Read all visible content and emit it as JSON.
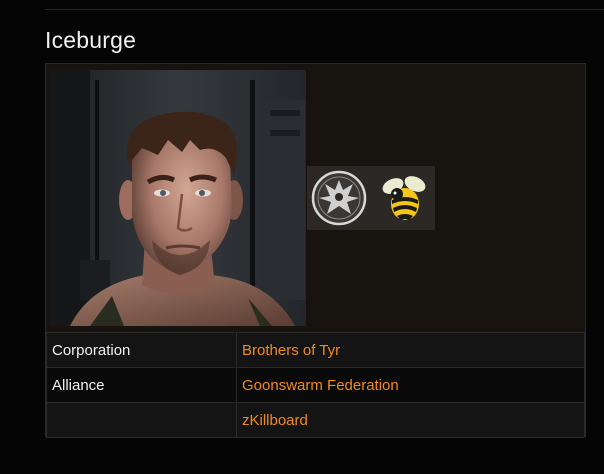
{
  "character": {
    "name": "Iceburge"
  },
  "images": {
    "portrait": "character-portrait",
    "corporation_logo": "phoenix-emblem-icon",
    "alliance_logo": "bee-icon"
  },
  "details": [
    {
      "label": "Corporation",
      "value": "Brothers of Tyr"
    },
    {
      "label": "Alliance",
      "value": "Goonswarm Federation"
    },
    {
      "label": "",
      "value": "zKillboard"
    }
  ],
  "colors": {
    "background": "#050505",
    "panel": "#17130f",
    "link": "#f28a1a",
    "text": "#f0f0f0",
    "border": "#2a2a2a"
  }
}
